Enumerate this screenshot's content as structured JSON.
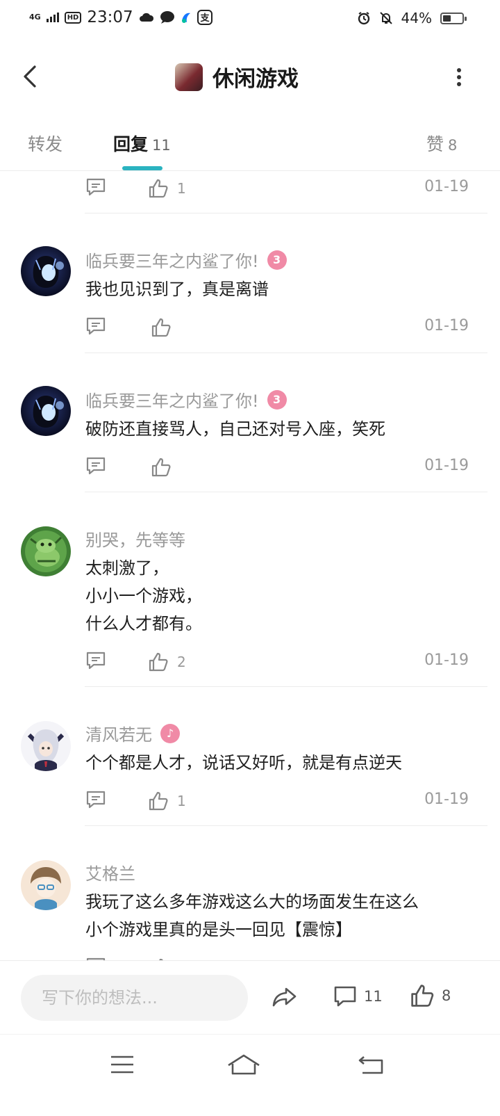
{
  "status_bar": {
    "network": "4G",
    "hd": "HD",
    "time": "23:07",
    "icons_left": [
      "cloud-icon",
      "chat-bubble-icon",
      "app-icon",
      "alipay-icon"
    ],
    "icons_right": [
      "alarm-icon",
      "mute-bell-icon"
    ],
    "battery_text": "44%",
    "battery_level": 0.44
  },
  "header": {
    "title": "休闲游戏",
    "back_icon": "chevron-left-icon",
    "more_icon": "more-vertical-icon"
  },
  "tabs": [
    {
      "label": "转发",
      "count": ""
    },
    {
      "label": "回复",
      "count": "11",
      "active": true
    },
    {
      "label": "赞",
      "count": "8"
    }
  ],
  "comments": [
    {
      "user": "",
      "badge": "",
      "lines": [],
      "likes": "1",
      "date": "01-19"
    },
    {
      "user": "临兵要三年之内鲨了你!",
      "badge": "3",
      "lines": [
        "我也见识到了，真是离谱"
      ],
      "likes": "",
      "date": "01-19",
      "avatar_colors": [
        "#0b0f2a",
        "#2b3a7a",
        "#cfe8ff"
      ]
    },
    {
      "user": "临兵要三年之内鲨了你!",
      "badge": "3",
      "lines": [
        "破防还直接骂人，自己还对号入座，笑死"
      ],
      "likes": "",
      "date": "01-19",
      "avatar_colors": [
        "#0b0f2a",
        "#2b3a7a",
        "#cfe8ff"
      ]
    },
    {
      "user": "别哭，先等等",
      "badge": "",
      "lines": [
        "太刺激了，",
        "小小一个游戏，",
        "什么人才都有。"
      ],
      "likes": "2",
      "date": "01-19",
      "avatar_colors": [
        "#4a8a3a",
        "#8cc86a",
        "#2e5a24"
      ]
    },
    {
      "user": "清风若无",
      "badge": "♪",
      "lines": [
        "个个都是人才，说话又好听，就是有点逆天"
      ],
      "likes": "1",
      "date": "01-19",
      "avatar_colors": [
        "#e8e8f0",
        "#2a2a4a",
        "#b8bcd0"
      ]
    },
    {
      "user": "艾格兰",
      "badge": "",
      "lines": [
        "我玩了这么多年游戏这么大的场面发生在这么",
        "小个游戏里真的是头一回见【震惊】"
      ],
      "likes": "",
      "date": "",
      "avatar_colors": [
        "#f6e6d6",
        "#4a90c0",
        "#8a6a4a"
      ]
    }
  ],
  "bottom_bar": {
    "input_placeholder": "写下你的想法...",
    "comment_count": "11",
    "like_count": "8"
  },
  "colors": {
    "accent": "#2bb3c0",
    "badge_pink": "#f08aa6",
    "meta_gray": "#9a9a9a"
  }
}
